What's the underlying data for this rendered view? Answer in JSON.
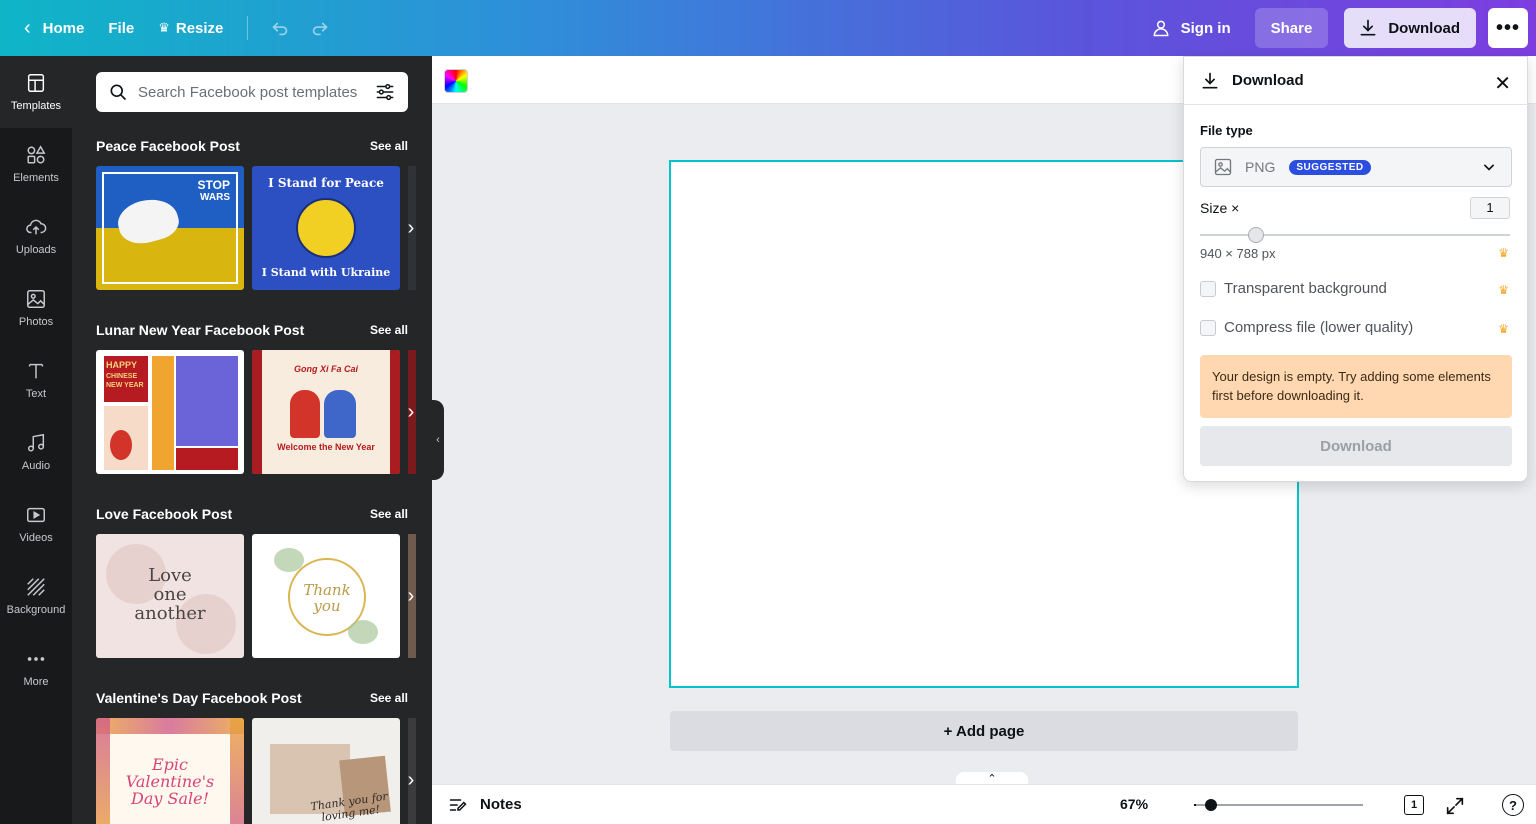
{
  "topbar": {
    "home_label": "Home",
    "file_label": "File",
    "resize_label": "Resize",
    "signin_label": "Sign in",
    "share_label": "Share",
    "download_label": "Download",
    "more_label": "•••"
  },
  "rail": {
    "items": [
      {
        "label": "Templates",
        "icon": "templates-icon"
      },
      {
        "label": "Elements",
        "icon": "elements-icon"
      },
      {
        "label": "Uploads",
        "icon": "uploads-icon"
      },
      {
        "label": "Photos",
        "icon": "photos-icon"
      },
      {
        "label": "Text",
        "icon": "text-icon"
      },
      {
        "label": "Audio",
        "icon": "audio-icon"
      },
      {
        "label": "Videos",
        "icon": "videos-icon"
      },
      {
        "label": "Background",
        "icon": "background-icon"
      },
      {
        "label": "More",
        "icon": "more-icon"
      }
    ]
  },
  "panel": {
    "search_placeholder": "Search Facebook post templates",
    "see_all": "See all",
    "sections": [
      {
        "title": "Peace Facebook Post",
        "thumbs": [
          {
            "text1": "STOP",
            "text2": "WARS"
          },
          {
            "text1": "I Stand for Peace",
            "text2": "I Stand with Ukraine"
          }
        ]
      },
      {
        "title": "Lunar New Year Facebook Post",
        "thumbs": [
          {
            "text1": "HAPPY",
            "text2": "CHINESE NEW YEAR"
          },
          {
            "text1": "Gong Xi Fa Cai",
            "text2": "Welcome the New Year"
          }
        ]
      },
      {
        "title": "Love Facebook Post",
        "thumbs": [
          {
            "text1": "Love one another"
          },
          {
            "text1": "Thank you"
          }
        ]
      },
      {
        "title": "Valentine's Day Facebook Post",
        "thumbs": [
          {
            "text1": "Epic Valentine's Day Sale!"
          },
          {
            "text1": "Thank you for loving me!"
          }
        ]
      }
    ]
  },
  "editor": {
    "add_page_label": "+ Add page",
    "notes_label": "Notes",
    "zoom_label": "67%",
    "zoom_fraction": 0.09,
    "page_count": "1"
  },
  "download_panel": {
    "title": "Download",
    "file_type_label": "File type",
    "file_type_value": "PNG",
    "suggested_badge": "SUGGESTED",
    "size_label": "Size ×",
    "size_value": "1",
    "size_slider_fraction": 0.18,
    "dimensions": "940 × 788 px",
    "transparent_label": "Transparent background",
    "compress_label": "Compress file (lower quality)",
    "warning": "Your design is empty. Try adding some elements first before downloading it.",
    "download_button": "Download"
  },
  "colors": {
    "accent_cyan": "#00c4cc",
    "badge_blue": "#2b4ee0",
    "warning_bg": "#ffd8b2",
    "crown": "#f6a623"
  }
}
